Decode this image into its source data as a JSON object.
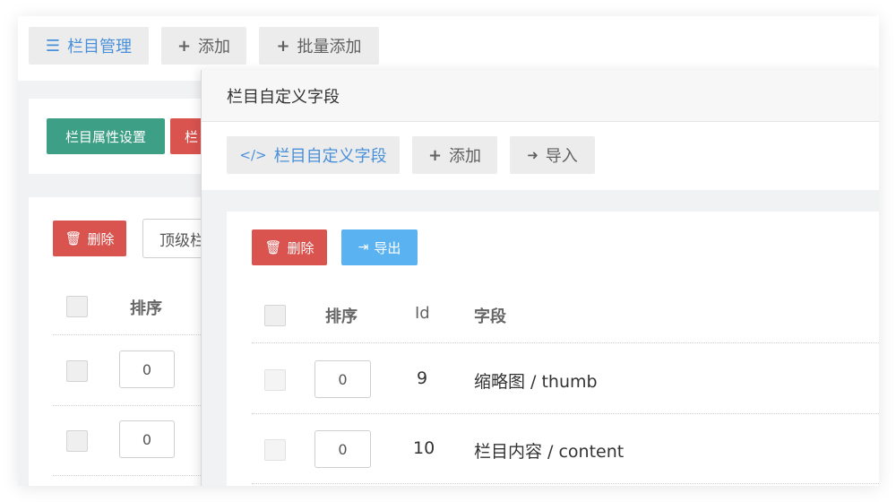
{
  "toolbar": {
    "manage_label": "栏目管理",
    "add_label": "添加",
    "batch_add_label": "批量添加"
  },
  "background": {
    "attr_settings_label": "栏目属性设置",
    "red_button_partial": "栏",
    "delete_label": "删除",
    "select_value_partial": "顶级栏",
    "sort_header": "排序",
    "rows": [
      {
        "sort": "0"
      },
      {
        "sort": "0"
      }
    ]
  },
  "modal": {
    "title": "栏目自定义字段",
    "tab_label": "栏目自定义字段",
    "add_label": "添加",
    "import_label": "导入",
    "delete_label": "删除",
    "export_label": "导出",
    "columns": {
      "sort": "排序",
      "id": "Id",
      "field": "字段"
    },
    "rows": [
      {
        "sort": "0",
        "id": "9",
        "field": "缩略图 / thumb"
      },
      {
        "sort": "0",
        "id": "10",
        "field": "栏目内容 / content"
      }
    ]
  },
  "colors": {
    "primary_blue": "#4a90d9",
    "success_green": "#3c9f86",
    "danger_red": "#d9534f",
    "info_blue": "#5ab2f0"
  }
}
